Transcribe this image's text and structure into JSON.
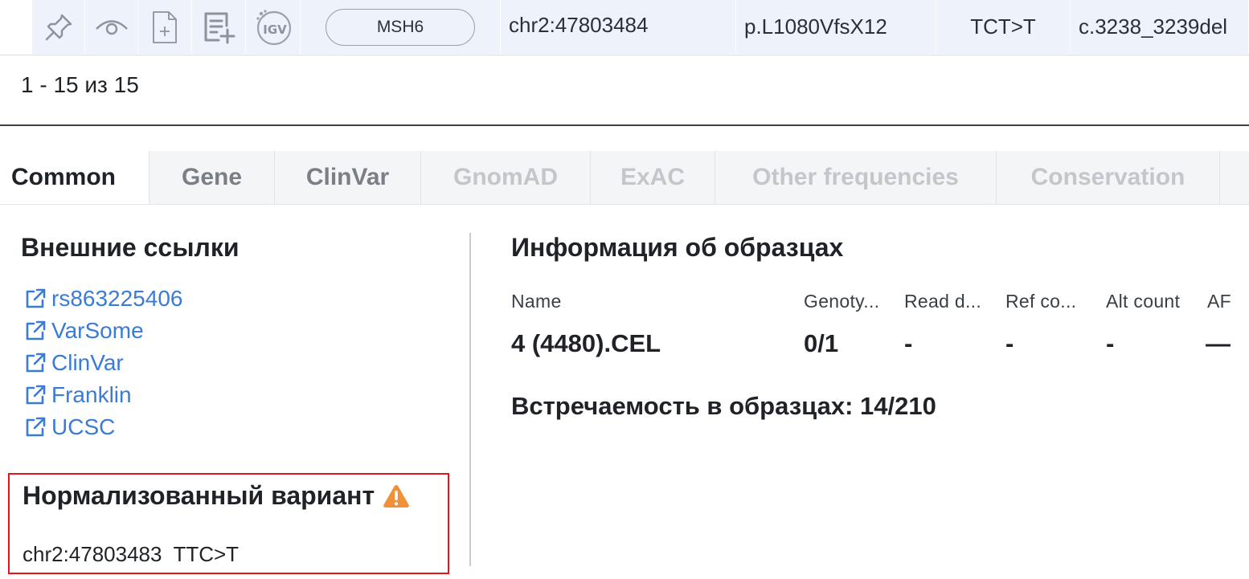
{
  "variant_row": {
    "actions": [
      {
        "name": "pin-icon"
      },
      {
        "name": "eye-icon"
      },
      {
        "name": "add-file-icon"
      },
      {
        "name": "add-list-icon"
      },
      {
        "name": "igv-icon",
        "label": "IGV"
      }
    ],
    "gene": "MSH6",
    "position": "chr2:47803484",
    "protein_change": "p.L1080VfsX12",
    "allele_change": "TCT>T",
    "cdna_change": "c.3238_3239del"
  },
  "pagination": {
    "text": "1 - 15 из 15"
  },
  "tabs": [
    {
      "label": "Common",
      "state": "active"
    },
    {
      "label": "Gene",
      "state": "mid"
    },
    {
      "label": "ClinVar",
      "state": "mid"
    },
    {
      "label": "GnomAD",
      "state": "light"
    },
    {
      "label": "ExAC",
      "state": "light"
    },
    {
      "label": "Other frequencies",
      "state": "light"
    },
    {
      "label": "Conservation",
      "state": "light"
    }
  ],
  "external_links": {
    "title": "Внешние ссылки",
    "items": [
      {
        "label": "rs863225406"
      },
      {
        "label": "VarSome"
      },
      {
        "label": "ClinVar"
      },
      {
        "label": "Franklin"
      },
      {
        "label": "UCSC"
      }
    ]
  },
  "normalized_variant": {
    "title": "Нормализованный вариант",
    "icon": "warning-icon",
    "value": "chr2:47803483  TTC>T"
  },
  "samples": {
    "title": "Информация об образцах",
    "headers": [
      "Name",
      "Genoty...",
      "Read d...",
      "Ref co...",
      "Alt count",
      "AF"
    ],
    "row": [
      "4 (4480).CEL",
      "0/1",
      "-",
      "-",
      "-",
      "—"
    ],
    "occurrence": "Встречаемость в образцах: 14/210"
  },
  "colors": {
    "link": "#3a7bd5",
    "warning": "#f0913a",
    "highlight_border": "#e0161f",
    "row_background": "#edf2fb"
  }
}
